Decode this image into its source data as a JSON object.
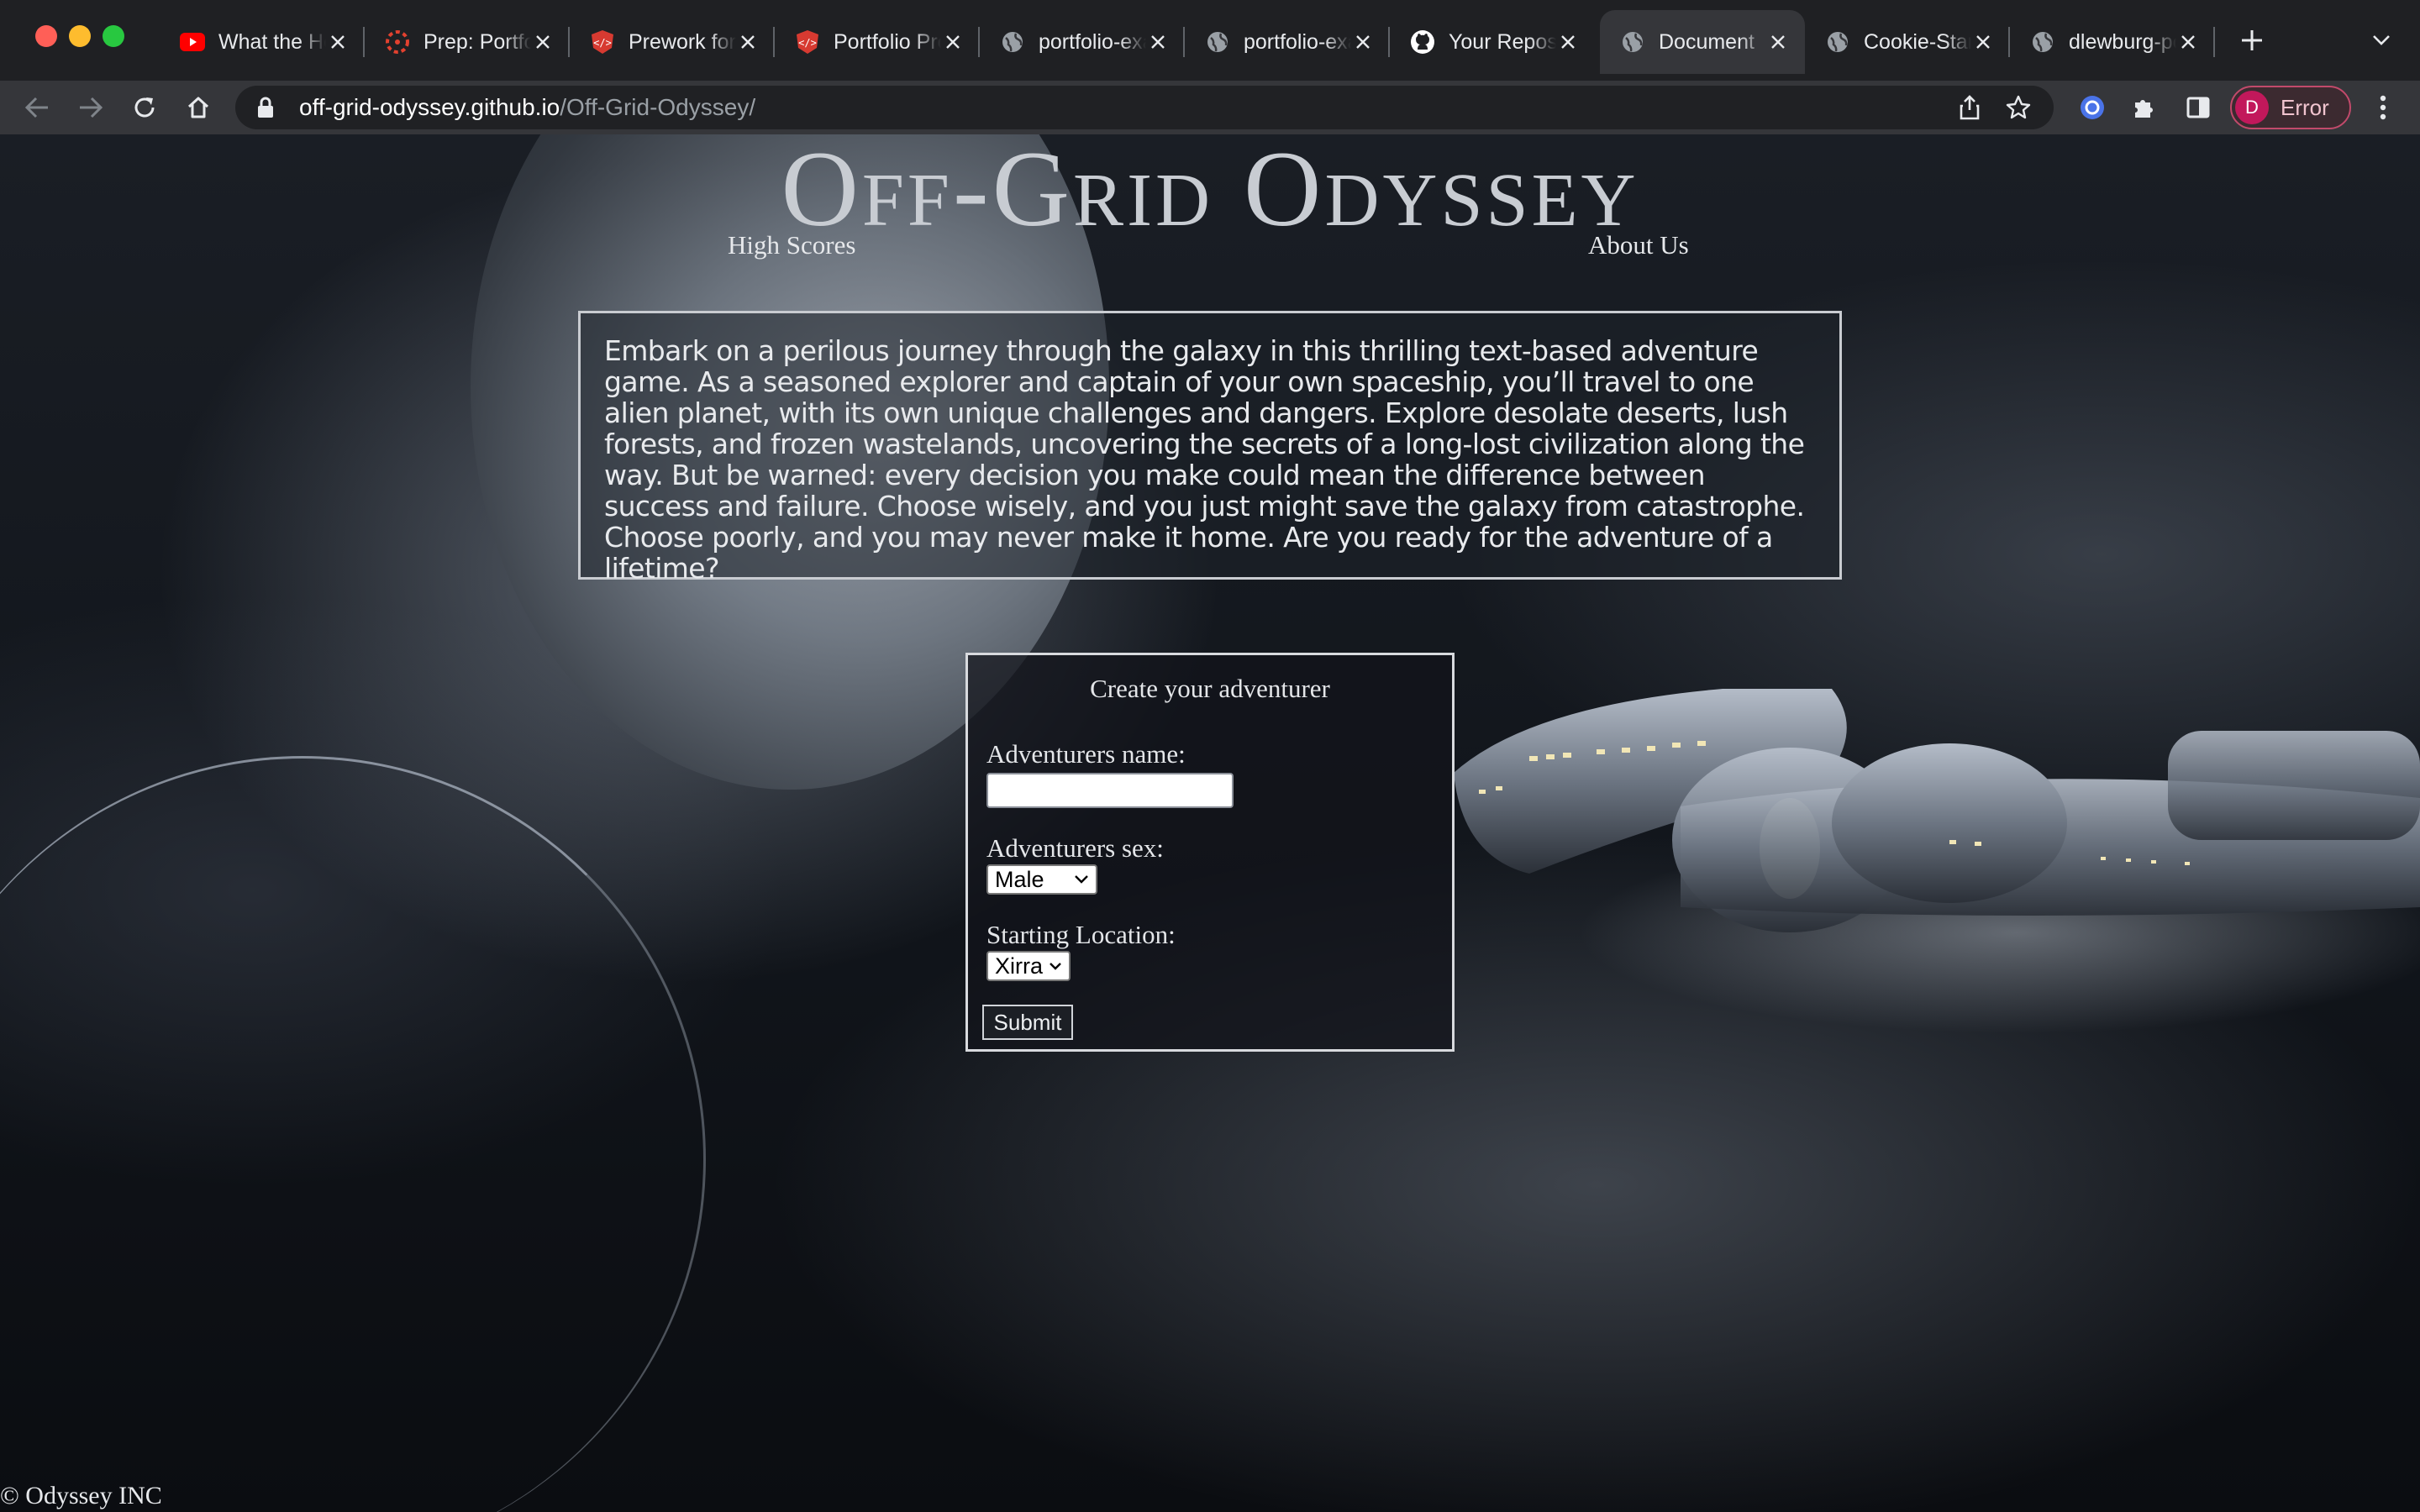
{
  "browser": {
    "tabs": [
      {
        "title": "What the Hell",
        "favicon": "youtube-icon",
        "color": "#ff0000"
      },
      {
        "title": "Prep: Portfolio",
        "favicon": "canvas-icon",
        "color": "#e2412f"
      },
      {
        "title": "Prework for",
        "favicon": "codefellows-icon",
        "color": "#d73a31"
      },
      {
        "title": "Portfolio Project",
        "favicon": "codefellows-icon",
        "color": "#d73a31"
      },
      {
        "title": "portfolio-example",
        "favicon": "globe-icon",
        "color": "#9aa0a6"
      },
      {
        "title": "portfolio-example",
        "favicon": "globe-icon",
        "color": "#9aa0a6"
      },
      {
        "title": "Your Repositories",
        "favicon": "github-icon",
        "color": "#ffffff"
      },
      {
        "title": "Document",
        "favicon": "globe-icon",
        "color": "#9aa0a6",
        "active": true
      },
      {
        "title": "Cookie-Stand",
        "favicon": "globe-icon",
        "color": "#9aa0a6"
      },
      {
        "title": "dlewburg-portfolio",
        "favicon": "globe-icon",
        "color": "#9aa0a6"
      }
    ],
    "url_host": "off-grid-odyssey.github.io",
    "url_path": "/Off-Grid-Odyssey/",
    "profile_initial": "D",
    "profile_status": "Error"
  },
  "page": {
    "title": "Off-Grid Odyssey",
    "nav": {
      "high_scores": "High Scores",
      "about_us": "About Us"
    },
    "intro": "Embark on a perilous journey through the galaxy in this thrilling text-based adventure game. As a seasoned explorer and captain of your own spaceship, you’ll travel to one alien planet, with its own unique challenges and dangers. Explore desolate deserts, lush forests, and frozen wastelands, uncovering the secrets of a long-lost civilization along the way. But be warned: every decision you make could mean the difference between success and failure. Choose wisely, and you just might save the galaxy from catastrophe. Choose poorly, and you may never make it home. Are you ready for the adventure of a lifetime?",
    "form": {
      "title": "Create your adventurer",
      "name_label": "Adventurers name:",
      "name_value": "",
      "sex_label": "Adventurers sex:",
      "sex_value": "Male",
      "location_label": "Starting Location:",
      "location_value": "Xirra",
      "submit_label": "Submit"
    },
    "footer": "© Odyssey INC"
  }
}
